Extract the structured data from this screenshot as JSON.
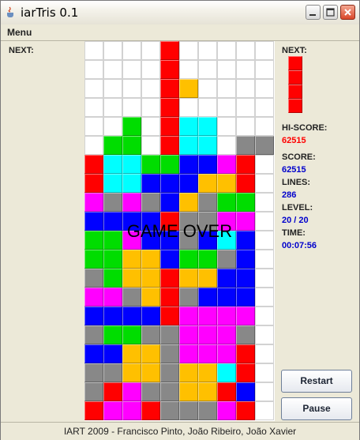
{
  "window": {
    "title": "iarTris 0.1"
  },
  "menu": {
    "label": "Menu"
  },
  "left_panel": {
    "next_label": "NEXT:"
  },
  "board": {
    "overlay_text": "GAME OVER",
    "rows": [
      "....R....",
      "....R....",
      "....RY...",
      "....R....",
      "..G.RCC..",
      ".GG.RCC.HH",
      "RCCGGBBMR",
      "RCCBBBYYR",
      "MHMHBYHGG",
      "BBBBRHHMM",
      "GGMBBHBCB",
      "GGYYBGGHB",
      "HGYYRYYBB",
      "MMHYRHBBB",
      "BBBBRMMMM",
      "HGGHHMMMH",
      "BBYYHMMMR",
      "HHYYHYYCR",
      "HRMHHYYRB",
      "RMMRHHHMR"
    ],
    "colors": {
      "R": "#ff0000",
      "G": "#00dd00",
      "B": "#0000ff",
      "C": "#00ffff",
      "Y": "#ffc000",
      "M": "#ff00ff",
      "H": "#888888"
    }
  },
  "right_panel": {
    "next_label": "NEXT:",
    "next_piece_color": "#ff0000",
    "hiscore_label": "HI-SCORE:",
    "hiscore_value": "62515",
    "score_label": "SCORE:",
    "score_value": "62515",
    "lines_label": "LINES:",
    "lines_value": "286",
    "level_label": "LEVEL:",
    "level_value": "20 / 20",
    "time_label": "TIME:",
    "time_value": "00:07:56",
    "restart_label": "Restart",
    "pause_label": "Pause"
  },
  "status_bar": {
    "text": "IART 2009 - Francisco Pinto, João Ribeiro, João Xavier"
  },
  "colors": {
    "hiscore": "#ff0000",
    "stats": "#0000cc"
  }
}
